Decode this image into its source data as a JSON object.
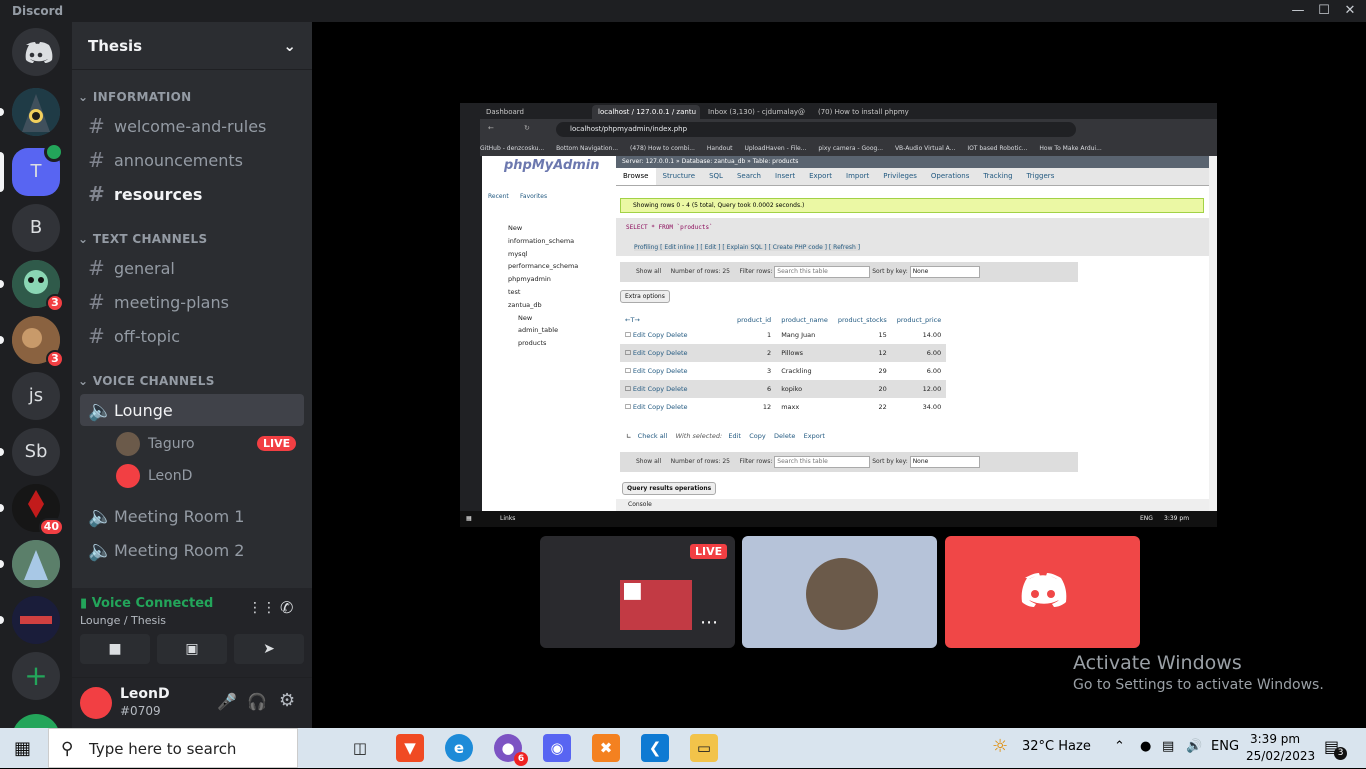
{
  "window": {
    "app_name": "Discord"
  },
  "servers": [
    {
      "label": ""
    },
    {
      "label": ""
    },
    {
      "label": "T"
    },
    {
      "label": "B"
    },
    {
      "label": "",
      "badge": "3"
    },
    {
      "label": "",
      "badge": "3"
    },
    {
      "label": "js"
    },
    {
      "label": "Sb"
    },
    {
      "label": "",
      "badge": "40"
    },
    {
      "label": ""
    },
    {
      "label": ""
    }
  ],
  "guild": {
    "name": "Thesis"
  },
  "categories": {
    "information": "INFORMATION",
    "text": "TEXT CHANNELS",
    "voice": "VOICE CHANNELS"
  },
  "info_channels": [
    "welcome-and-rules",
    "announcements",
    "resources"
  ],
  "text_channels": [
    "general",
    "meeting-plans",
    "off-topic"
  ],
  "voice_channels": [
    "Lounge",
    "Meeting Room 1",
    "Meeting Room 2"
  ],
  "voice_users": [
    {
      "name": "Taguro",
      "live": "LIVE"
    },
    {
      "name": "LeonD"
    }
  ],
  "voice_panel": {
    "status": "Voice Connected",
    "location": "Lounge / Thesis"
  },
  "user": {
    "name": "LeonD",
    "tag": "#0709"
  },
  "browser": {
    "tabs": [
      "Dashboard",
      "localhost / 127.0.0.1 / zantu",
      "Inbox (3,130) - cjdumalay@",
      "(70) How to install phpmy"
    ],
    "url": "localhost/phpmyadmin/index.php",
    "bookmarks": [
      "GitHub - denzcosku...",
      "Bottom Navigation...",
      "(478) How to combi...",
      "Handout",
      "UploadHaven - File...",
      "pixy camera - Goog...",
      "VB-Audio Virtual A...",
      "IOT based Robotic...",
      "How To Make Ardui..."
    ]
  },
  "pma": {
    "logo": "phpMyAdmin",
    "recent": "Recent",
    "favorites": "Favorites",
    "tree": [
      "New",
      "information_schema",
      "mysql",
      "performance_schema",
      "phpmyadmin",
      "test",
      "zantua_db",
      "New",
      "admin_table",
      "products"
    ],
    "breadcrumb": "Server: 127.0.0.1 » Database: zantua_db » Table: products",
    "tabs": [
      "Browse",
      "Structure",
      "SQL",
      "Search",
      "Insert",
      "Export",
      "Import",
      "Privileges",
      "Operations",
      "Tracking",
      "Triggers"
    ],
    "success": "Showing rows 0 - 4 (5 total, Query took 0.0002 seconds.)",
    "query": "SELECT * FROM `products`",
    "profiling": "Profiling [ Edit inline ] [ Edit ] [ Explain SQL ] [ Create PHP code ] [ Refresh ]",
    "show_all": "Show all",
    "num_rows_label": "Number of rows:",
    "num_rows": "25",
    "filter_label": "Filter rows:",
    "filter_placeholder": "Search this table",
    "sort_label": "Sort by key:",
    "sort_value": "None",
    "extra_options": "Extra options",
    "columns": [
      "product_id",
      "product_name",
      "product_stocks",
      "product_price"
    ],
    "rows": [
      [
        "1",
        "Mang Juan",
        "15",
        "14.00"
      ],
      [
        "2",
        "Pillows",
        "12",
        "6.00"
      ],
      [
        "3",
        "Crackling",
        "29",
        "6.00"
      ],
      [
        "6",
        "kopiko",
        "20",
        "12.00"
      ],
      [
        "12",
        "maxx",
        "22",
        "34.00"
      ]
    ],
    "row_actions": [
      "Edit",
      "Copy",
      "Delete"
    ],
    "check_all": "Check all",
    "with_selected": "With selected:",
    "bulk_actions": [
      "Edit",
      "Copy",
      "Delete",
      "Export"
    ],
    "query_ops": "Query results operations",
    "console": "Console"
  },
  "win_inner": {
    "links": "Links",
    "lang": "ENG",
    "time": "3:39 pm"
  },
  "stream_live": "LIVE",
  "activate": {
    "title": "Activate Windows",
    "sub": "Go to Settings to activate Windows."
  },
  "taskbar": {
    "search_placeholder": "Type here to search",
    "weather": "32°C  Haze",
    "lang": "ENG",
    "time": "3:39 pm",
    "date": "25/02/2023",
    "chrome_badge": "6",
    "notif_count": "3"
  }
}
